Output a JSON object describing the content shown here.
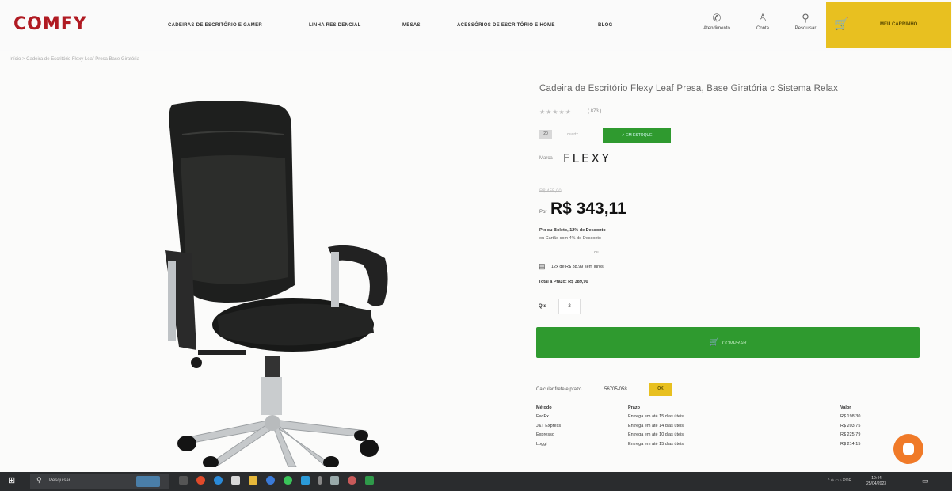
{
  "header": {
    "logo": "COMFY",
    "nav": [
      "CADEIRAS DE ESCRITÓRIO E GAMER",
      "LINHA RESIDENCIAL",
      "MESAS",
      "ACESSÓRIOS DE ESCRITÓRIO E HOME",
      "BLOG"
    ],
    "actions": [
      {
        "icon": "whatsapp-icon",
        "label": "Atendimento"
      },
      {
        "icon": "user-icon",
        "label": "Conta"
      },
      {
        "icon": "search-icon",
        "label": "Pesquisar"
      }
    ],
    "cart": {
      "icon": "cart-icon",
      "label": "MEU CARRINHO"
    }
  },
  "breadcrumb": "Início > Cadeira de Escritório Flexy Leaf Presa Base Giratória",
  "product": {
    "title": "Cadeira de Escritório Flexy Leaf Presa, Base Giratória c Sistema Relax",
    "stars": "★★★★★",
    "reviews": "( 873 )",
    "tag_box": "20",
    "tag_text": "quartz",
    "badge": "✓ EM ESTOQUE",
    "brand_label": "Marca",
    "brand": "FLEXY",
    "old_price": "R$ 455,00",
    "price_prefix": "Por",
    "price": "R$ 343,11",
    "payment_line1": "Pix ou Boleto, 12% de Desconto",
    "payment_line2": "ou Cartão com 4% de Desconto",
    "or": "ou",
    "installment": "12x de R$ 38,99 sem juros",
    "total": "Total a Prazo: R$ 389,90",
    "qty_label": "Qtd",
    "qty_value": "2",
    "buy_button": "COMPRAR"
  },
  "shipping": {
    "label": "Calcular frete e prazo",
    "cep": "56705-058",
    "ok": "OK",
    "columns": [
      "Método",
      "Prazo",
      "Valor"
    ],
    "rows": [
      [
        "FedEx",
        "Entrega em até 15 dias úteis",
        "R$ 198,30"
      ],
      [
        "J&T Express",
        "Entrega em até 14 dias úteis",
        "R$ 203,75"
      ],
      [
        "Expresso",
        "Entrega em até 10 dias úteis",
        "R$ 225,79"
      ],
      [
        "Loggi",
        "Entrega em até 15 dias úteis",
        "R$ 214,15"
      ]
    ]
  },
  "taskbar": {
    "search_placeholder": "Pesquisar",
    "tray": "^  ⊕  ▭  ♪  POR",
    "time": "10:44",
    "date": "25/04/2023"
  },
  "colors": {
    "brand_red": "#b01a22",
    "accent_yellow": "#e8c020",
    "buy_green": "#2f9a2f",
    "chat_orange": "#f07a28"
  }
}
